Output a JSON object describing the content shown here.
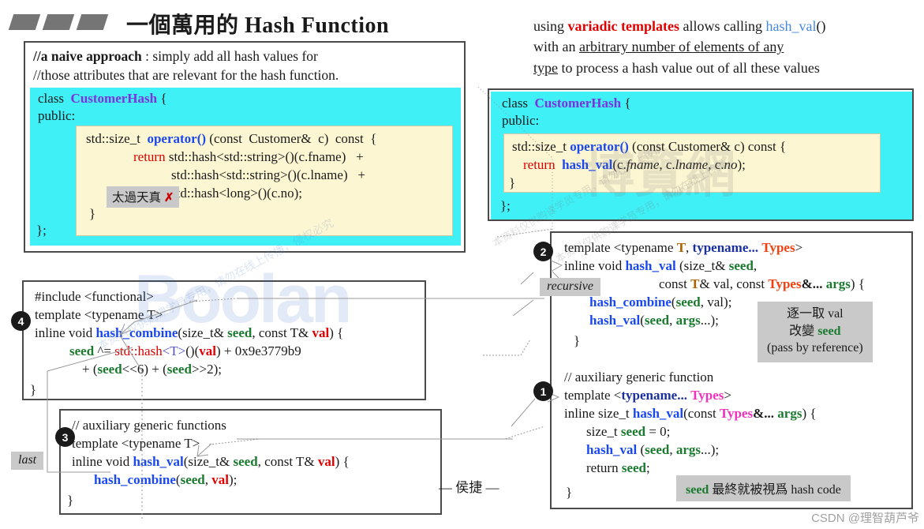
{
  "title": "一個萬用的 Hash Function",
  "naive_panel": {
    "comment_line1_bold": "//a naive approach",
    "comment_line1_rest": " : simply add all hash values for",
    "comment_line2": "//those attributes that are relevant for the hash function.",
    "class_kw": "class",
    "class_name": "CustomerHash",
    "brace_open": "{",
    "access": "public:",
    "sig_type": "std::size_t",
    "sig_op": "operator()",
    "sig_rest": " (const  Customer&  c)  const  {",
    "ret_kw": "return",
    "ret_line1": " std::hash<std::string>()(c.fname)   +",
    "ret_line2": "std::hash<std::string>()(c.lname)   +",
    "ret_line3": "std::hash<long>()(c.no);",
    "inner_close": "}",
    "class_close": "};",
    "naive_tag": "太過天真",
    "naive_tag_mark": "✗"
  },
  "intro": {
    "l1_a": "using ",
    "l1_b": "variadic templates",
    "l1_c": " allows calling ",
    "l1_d": "hash_val",
    "l1_e": "()",
    "l2_a": "with an ",
    "l2_b": "arbitrary number of elements of any",
    "l3_a": "type",
    "l3_b": " to process a hash value out of all these values"
  },
  "variadic_panel": {
    "class_kw": "class",
    "class_name": "CustomerHash",
    "brace_open": "{",
    "access": "public:",
    "sig_type": "std::size_t ",
    "sig_op": "operator()",
    "sig_rest": " (const Customer& c) const {",
    "ret_kw": "return",
    "ret_fn": "hash_val",
    "ret_args_a": "(c.",
    "ret_args_fname": "fname",
    "ret_args_b": ", c.",
    "ret_args_lname": "lname",
    "ret_args_c": ", c.",
    "ret_args_no": "no",
    "ret_args_d": ");",
    "inner_close": "}",
    "class_close": "};"
  },
  "combine_panel": {
    "badge": "4",
    "line1": "#include <functional>",
    "line2": "template <typename T>",
    "line3_a": "inline void ",
    "line3_fn": "hash_combine",
    "line3_b": "(size_t& ",
    "line3_seed": "seed",
    "line3_c": ", const T& ",
    "line3_val": "val",
    "line3_d": ") {",
    "line4_seed": "seed",
    "line4_a": " ^= ",
    "line4_hash": "std::hash",
    "line4_tparam": "<T>",
    "line4_b": "()(",
    "line4_val": "val",
    "line4_c": ") + 0x9e3779b9",
    "line5_a": "+ (",
    "line5_seed1": "seed",
    "line5_b": "<<6) + (",
    "line5_seed2": "seed",
    "line5_c": ">>2);",
    "close": "}"
  },
  "last_panel": {
    "badge": "3",
    "tag": "last",
    "comment": "// auxiliary generic functions",
    "line2": "template <typename T>",
    "line3_a": "inline void ",
    "line3_fn": "hash_val",
    "line3_b": "(size_t& ",
    "line3_seed": "seed",
    "line3_c": ", const T& ",
    "line3_val": "val",
    "line3_d": ") {",
    "line4_fn": "hash_combine",
    "line4_a": "(",
    "line4_seed": "seed",
    "line4_b": ", ",
    "line4_val": "val",
    "line4_c": ");",
    "close": "}"
  },
  "right_panel": {
    "recursive": {
      "badge": "2",
      "tag": "recursive",
      "l1_a": "template <typename ",
      "l1_T": "T",
      "l1_b": ", ",
      "l1_typename": "typename...",
      "l1_c": " ",
      "l1_Types": "Types",
      "l1_d": ">",
      "l2_a": "inline void ",
      "l2_fn": "hash_val",
      "l2_b": " (size_t& ",
      "l2_seed": "seed",
      "l2_c": ",",
      "l3_a": "const ",
      "l3_T": "T",
      "l3_b": "& val, const ",
      "l3_Types": "Types",
      "l3_c": "&...",
      "l3_d": " ",
      "l3_args": "args",
      "l3_e": ") {",
      "l4_fn": "hash_combine",
      "l4_a": "(",
      "l4_seed": "seed",
      "l4_b": ", val);",
      "l5_fn": "hash_val",
      "l5_a": "(",
      "l5_seed": "seed",
      "l5_b": ", ",
      "l5_args": "args",
      "l5_c": "...);",
      "close": "}"
    },
    "note_byref_l1_a": "逐一取 val",
    "note_byref_l2_a": "改變 ",
    "note_byref_l2_seed": "seed",
    "note_byref_l3": "(pass by reference)",
    "auxiliary": {
      "badge": "1",
      "comment": "// auxiliary generic function",
      "l1_a": "template <",
      "l1_typename": "typename...",
      "l1_b": " ",
      "l1_Types": "Types",
      "l1_c": ">",
      "l2_a": "inline size_t ",
      "l2_fn": "hash_val",
      "l2_b": "(const ",
      "l2_Types": "Types",
      "l2_c": "&...",
      "l2_d": " ",
      "l2_args": "args",
      "l2_e": ") {",
      "l3_a": "size_t ",
      "l3_seed": "seed",
      "l3_b": " = 0;",
      "l4_fn": "hash_val",
      "l4_a": " (",
      "l4_seed": "seed",
      "l4_b": ", ",
      "l4_args": "args",
      "l4_c": "...);",
      "l5_a": "return ",
      "l5_seed": "seed",
      "l5_b": ";",
      "close": "}"
    },
    "note_seedcode_a": "seed",
    "note_seedcode_b": " 最終就被視爲 hash code"
  },
  "signature": "— 侯捷 —",
  "watermarks": {
    "boolan": "Boolan",
    "boolan_cn": "博覽網",
    "diag1": "本资料仅供购课学员专用，请勿在线上传播，侵权必究",
    "diag2": "本资料仅供购课学员专用，请勿在线上传播",
    "diag3": "本资料仅供购课学员专用，请勿在线上传播",
    "csdn": "CSDN @理智葫芦爷"
  },
  "colors": {
    "cyan": "#3ff0f7",
    "cream": "#fdf6d3",
    "gray_tag": "#c9c9c9",
    "border": "#4a4a4a",
    "purple": "#7d32e0",
    "blue": "#1a48f0",
    "red": "#e00000",
    "green": "#1a7a2e",
    "orange": "#b06000",
    "orangered": "#f04010",
    "magenta": "#f030c0"
  }
}
